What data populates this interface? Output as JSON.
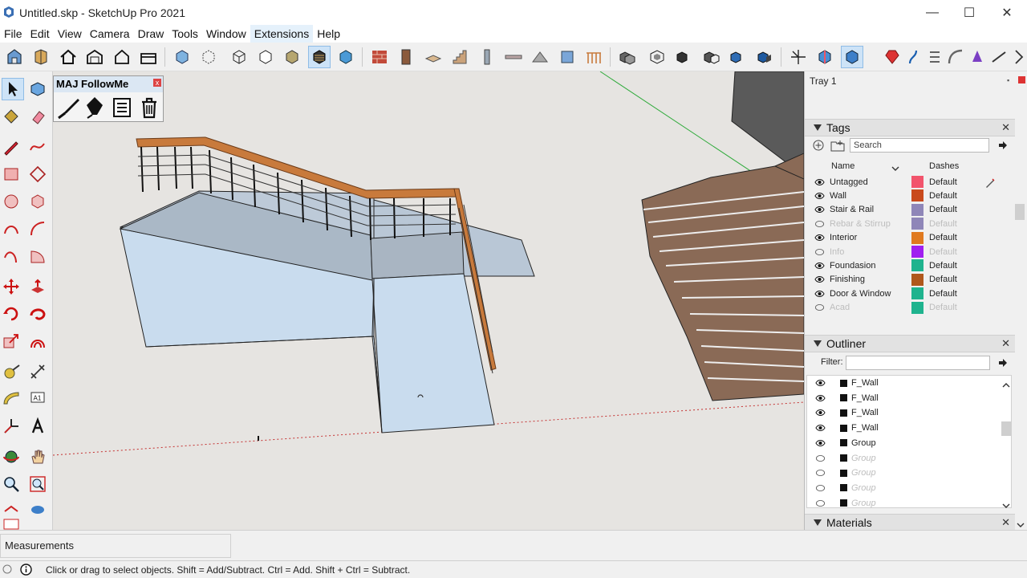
{
  "window": {
    "title": "Untitled.skp - SketchUp Pro 2021",
    "minimize": "—",
    "maximize": "☐",
    "close": "✕"
  },
  "menu": [
    "File",
    "Edit",
    "View",
    "Camera",
    "Draw",
    "Tools",
    "Window",
    "Extensions",
    "Help"
  ],
  "floating_toolbar": {
    "title": "MAJ FollowMe",
    "close": "x"
  },
  "tray": {
    "title": "Tray 1",
    "pin": "⊡",
    "tags": {
      "title": "Tags",
      "close": "✕",
      "search_placeholder": "Search",
      "col_name": "Name",
      "col_dashes": "Dashes",
      "items": [
        {
          "name": "Untagged",
          "color": "#f2546c",
          "dashes": "Default",
          "visible": true
        },
        {
          "name": "Wall",
          "color": "#c94a1c",
          "dashes": "Default",
          "visible": true
        },
        {
          "name": "Stair & Rail",
          "color": "#8f86b8",
          "dashes": "Default",
          "visible": true
        },
        {
          "name": "Rebar & Stirrup",
          "color": "#8f86b8",
          "dashes": "Default",
          "visible": false
        },
        {
          "name": "Interior",
          "color": "#e07a20",
          "dashes": "Default",
          "visible": true
        },
        {
          "name": "Info",
          "color": "#a020f0",
          "dashes": "Default",
          "visible": false
        },
        {
          "name": "Foundasion",
          "color": "#1fb38e",
          "dashes": "Default",
          "visible": true
        },
        {
          "name": "Finishing",
          "color": "#b0581c",
          "dashes": "Default",
          "visible": true
        },
        {
          "name": "Door & Window",
          "color": "#1fb38e",
          "dashes": "Default",
          "visible": true
        },
        {
          "name": "Acad",
          "color": "#1fb38e",
          "dashes": "Default",
          "visible": false
        }
      ]
    },
    "outliner": {
      "title": "Outliner",
      "close": "✕",
      "filter_label": "Filter:",
      "items": [
        {
          "name": "F_Wall",
          "visible": true
        },
        {
          "name": "F_Wall",
          "visible": true
        },
        {
          "name": "F_Wall",
          "visible": true
        },
        {
          "name": "F_Wall",
          "visible": true
        },
        {
          "name": "Group",
          "visible": true
        },
        {
          "name": "Group",
          "visible": false
        },
        {
          "name": "Group",
          "visible": false
        },
        {
          "name": "Group",
          "visible": false
        },
        {
          "name": "Group",
          "visible": false
        }
      ]
    },
    "materials": {
      "title": "Materials",
      "close": "✕"
    }
  },
  "measurements": {
    "label": "Measurements"
  },
  "status": {
    "hint": "Click or drag to select objects. Shift = Add/Subtract. Ctrl = Add. Shift + Ctrl = Subtract."
  },
  "colors": {
    "wall_face": "#c9dcee",
    "rail_wood": "#c87a3c",
    "stair_wood": "#8a6a56",
    "axis_green": "#2eaa3a",
    "axis_red": "#c43030",
    "viewport_bg": "#e6e4e1"
  }
}
